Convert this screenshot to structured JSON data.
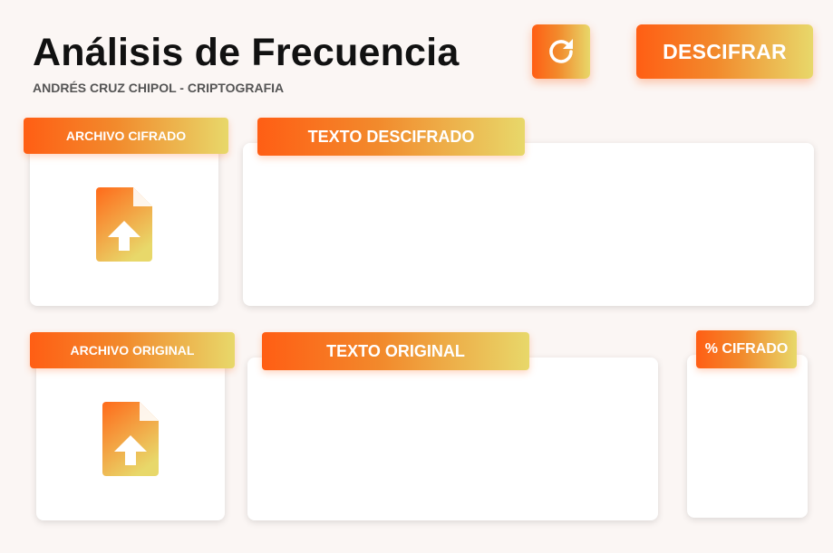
{
  "header": {
    "title": "Análisis de Frecuencia",
    "subtitle": "ANDRÉS CRUZ CHIPOL - CRIPTOGRAFIA",
    "refresh_icon": "refresh-icon",
    "decrypt_label": "DESCIFRAR"
  },
  "panels": {
    "encrypted_file_label": "ARCHIVO CIFRADO",
    "decrypted_text_label": "TEXTO DESCIFRADO",
    "original_file_label": "ARCHIVO ORIGINAL",
    "original_text_label": "TEXTO ORIGINAL",
    "encrypted_percent_label": "% CIFRADO",
    "upload_icon": "file-upload-icon"
  },
  "colors": {
    "accent_start": "#ff5e14",
    "accent_end": "#e8d86a",
    "background": "#fbf6f4"
  }
}
